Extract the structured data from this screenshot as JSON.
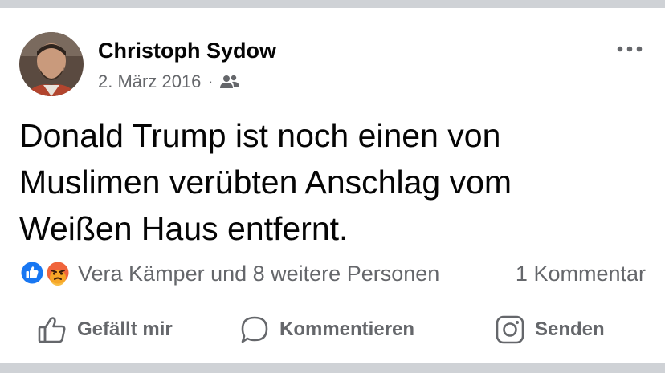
{
  "post": {
    "author": "Christoph Sydow",
    "date": "2. März 2016",
    "separator": "·",
    "audience_icon": "friends-icon",
    "text_lines": [
      "Donald Trump ist noch einen von",
      "Muslimen verübten Anschlag vom",
      "Weißen Haus entfernt."
    ]
  },
  "reactions": {
    "icons": [
      "like-reaction-icon",
      "angry-reaction-icon"
    ],
    "summary": "Vera Kämper und 8 weitere Personen",
    "comment_count": "1 Kommentar"
  },
  "actions": {
    "like_label": "Gefällt mir",
    "comment_label": "Kommentieren",
    "send_label": "Senden"
  },
  "colors": {
    "text_primary": "#050505",
    "text_secondary": "#65676b",
    "like_blue": "#1877f2",
    "angry_orange": "#f0643b",
    "divider": "#cfd2d6"
  }
}
